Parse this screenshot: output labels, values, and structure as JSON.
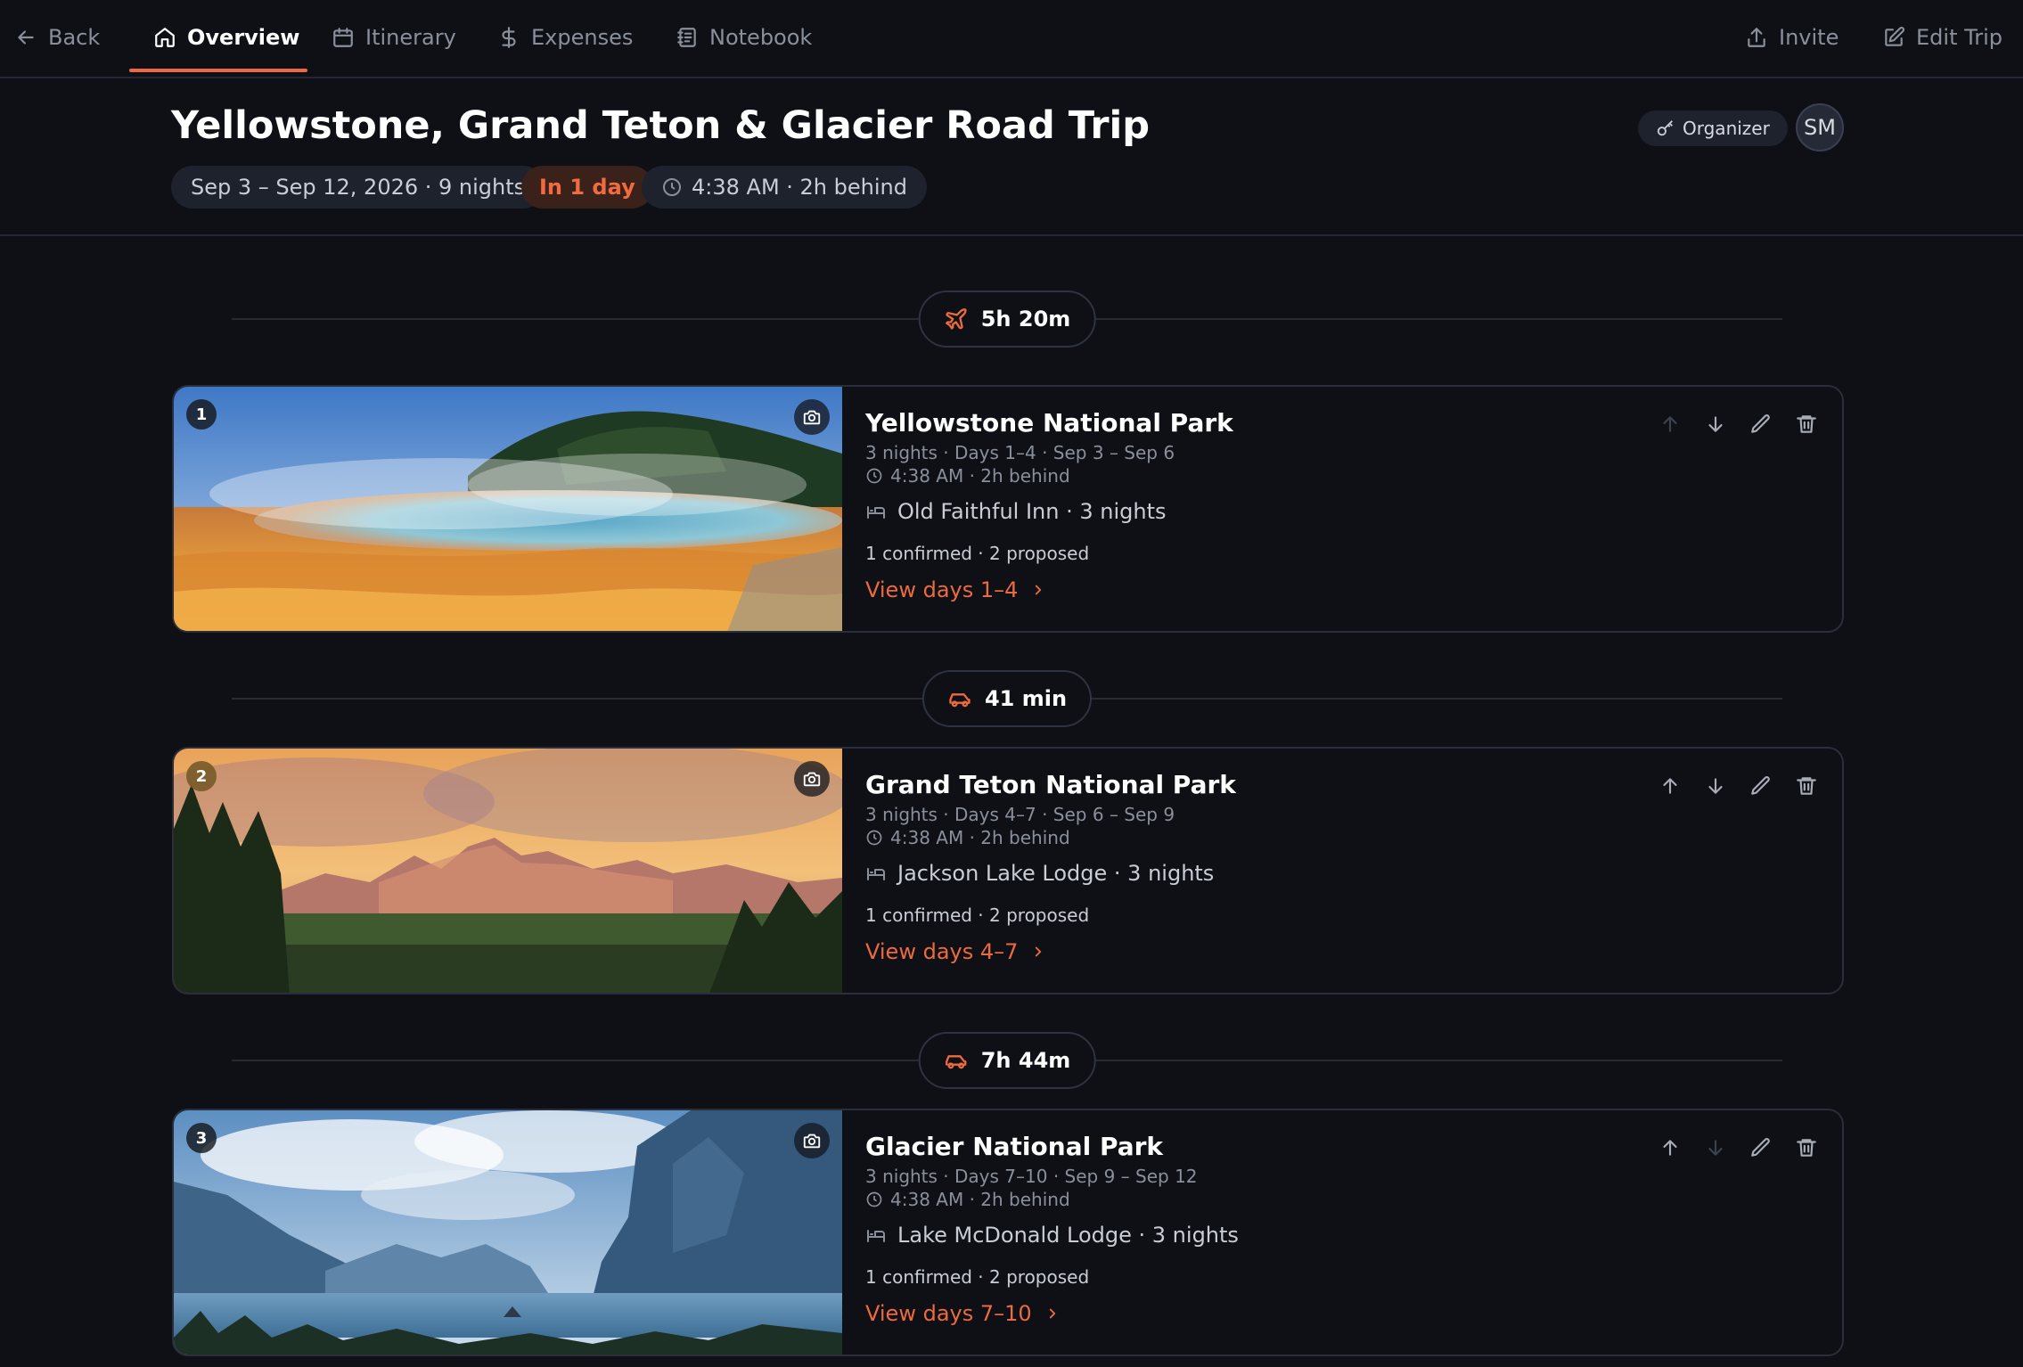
{
  "nav": {
    "back_label": "Back",
    "tabs": [
      {
        "label": "Overview",
        "icon": "home-icon",
        "active": true
      },
      {
        "label": "Itinerary",
        "icon": "calendar-icon",
        "active": false
      },
      {
        "label": "Expenses",
        "icon": "dollar-icon",
        "active": false
      },
      {
        "label": "Notebook",
        "icon": "notebook-icon",
        "active": false
      }
    ],
    "invite_label": "Invite",
    "edit_label": "Edit Trip"
  },
  "trip": {
    "title": "Yellowstone, Grand Teton & Glacier Road Trip",
    "dates": "Sep 3 – Sep 12, 2026 · 9 nights",
    "countdown": "In 1 day",
    "local_time": "4:38 AM · 2h behind",
    "role": "Organizer",
    "avatar_initials": "SM"
  },
  "colors": {
    "accent": "#ec6a3e",
    "background": "#0e1015",
    "border": "#2a2e3a"
  },
  "legs": [
    {
      "mode": "flight",
      "icon": "plane-icon",
      "duration": "5h 20m"
    },
    {
      "mode": "drive",
      "icon": "car-icon",
      "duration": "41 min"
    },
    {
      "mode": "drive",
      "icon": "car-icon",
      "duration": "7h 44m"
    }
  ],
  "stops": [
    {
      "number": "1",
      "name": "Yellowstone National Park",
      "meta": "3 nights · Days 1–4 · Sep 3 – Sep 6",
      "local_time": "4:38 AM · 2h behind",
      "lodging": "Old Faithful Inn · 3 nights",
      "status": "1 confirmed · 2 proposed",
      "link": "View days 1–4",
      "photo": "grand-prismatic-spring",
      "move_up_enabled": false,
      "move_down_enabled": true
    },
    {
      "number": "2",
      "name": "Grand Teton National Park",
      "meta": "3 nights · Days 4–7 · Sep 6 – Sep 9",
      "local_time": "4:38 AM · 2h behind",
      "lodging": "Jackson Lake Lodge · 3 nights",
      "status": "1 confirmed · 2 proposed",
      "link": "View days 4–7",
      "photo": "teton-range-sunset",
      "move_up_enabled": true,
      "move_down_enabled": true
    },
    {
      "number": "3",
      "name": "Glacier National Park",
      "meta": "3 nights · Days 7–10 · Sep 9 – Sep 12",
      "local_time": "4:38 AM · 2h behind",
      "lodging": "Lake McDonald Lodge · 3 nights",
      "status": "1 confirmed · 2 proposed",
      "link": "View days 7–10",
      "photo": "mountain-lake",
      "move_up_enabled": true,
      "move_down_enabled": false
    }
  ]
}
